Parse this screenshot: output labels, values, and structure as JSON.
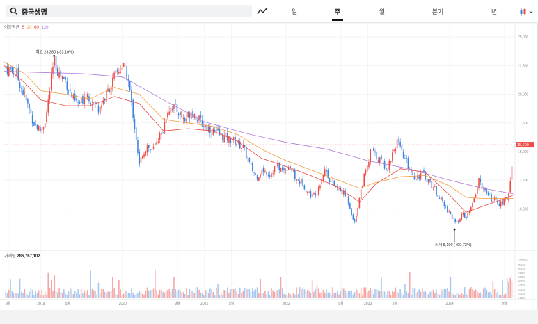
{
  "header": {
    "stock_name": "중국생명",
    "search_icon": "search-icon",
    "chart_type_icon": "line-chart-icon",
    "chart_style_icon": "candlestick-icon",
    "tabs": [
      {
        "label": "일",
        "active": false
      },
      {
        "label": "주",
        "active": true
      },
      {
        "label": "월",
        "active": false
      },
      {
        "label": "분기",
        "active": false
      },
      {
        "label": "년",
        "active": false
      }
    ]
  },
  "legend": {
    "title": "이동평균",
    "periods": [
      {
        "label": "5",
        "color": "#e8453c"
      },
      {
        "label": "20",
        "color": "#f29a3a"
      },
      {
        "label": "60",
        "color": "#e8453c"
      },
      {
        "label": "120",
        "color": "#b07ad8"
      }
    ]
  },
  "volume": {
    "label": "거래량",
    "value": "286,767,102"
  },
  "colors": {
    "up": "#ee4b45",
    "down": "#3b82e0",
    "ma5": "#e8453c",
    "ma20": "#f29a3a",
    "ma60": "#e8453c",
    "ma120": "#b07ad8",
    "current_badge": "#ee4b45"
  },
  "chart_data": {
    "type": "candlestick",
    "title": "",
    "xlabel": "",
    "ylabel": "",
    "ylim": [
      6500,
      25800
    ],
    "y_ticks": [
      {
        "value": 25000,
        "label": "25,000"
      },
      {
        "value": 22500,
        "label": "22,500"
      },
      {
        "value": 20000,
        "label": "20,000"
      },
      {
        "value": 17500,
        "label": "17,500"
      },
      {
        "value": 15000,
        "label": "15,000"
      },
      {
        "value": 12500,
        "label": "12,500"
      },
      {
        "value": 10000,
        "label": "10,000"
      }
    ],
    "x_ticks": [
      "9월",
      "2019",
      "5월",
      "2020",
      "9월",
      "2021",
      "5월",
      "2022",
      "9월",
      "2023",
      "5월",
      "2024",
      "9월"
    ],
    "price_path": [
      [
        2018.58,
        22300
      ],
      [
        2018.7,
        21800
      ],
      [
        2018.8,
        19800
      ],
      [
        2018.92,
        17400
      ],
      [
        2019.0,
        16800
      ],
      [
        2019.06,
        17900
      ],
      [
        2019.12,
        21000
      ],
      [
        2019.16,
        22900
      ],
      [
        2019.22,
        21800
      ],
      [
        2019.3,
        21200
      ],
      [
        2019.4,
        19400
      ],
      [
        2019.48,
        19100
      ],
      [
        2019.55,
        20200
      ],
      [
        2019.62,
        19500
      ],
      [
        2019.7,
        18800
      ],
      [
        2019.76,
        19400
      ],
      [
        2019.82,
        20300
      ],
      [
        2019.88,
        21200
      ],
      [
        2019.94,
        22000
      ],
      [
        2020.0,
        22500
      ],
      [
        2020.06,
        21500
      ],
      [
        2020.1,
        19600
      ],
      [
        2020.16,
        16500
      ],
      [
        2020.2,
        13600
      ],
      [
        2020.24,
        14800
      ],
      [
        2020.3,
        15500
      ],
      [
        2020.36,
        14900
      ],
      [
        2020.42,
        16100
      ],
      [
        2020.48,
        16500
      ],
      [
        2020.54,
        18500
      ],
      [
        2020.6,
        19000
      ],
      [
        2020.68,
        18500
      ],
      [
        2020.76,
        17700
      ],
      [
        2020.84,
        18600
      ],
      [
        2020.92,
        17800
      ],
      [
        2021.0,
        17300
      ],
      [
        2021.1,
        16800
      ],
      [
        2021.2,
        16400
      ],
      [
        2021.3,
        16100
      ],
      [
        2021.4,
        15800
      ],
      [
        2021.48,
        15300
      ],
      [
        2021.56,
        13700
      ],
      [
        2021.64,
        12800
      ],
      [
        2021.72,
        13400
      ],
      [
        2021.8,
        13000
      ],
      [
        2021.88,
        13800
      ],
      [
        2021.96,
        13300
      ],
      [
        2022.04,
        13800
      ],
      [
        2022.12,
        12500
      ],
      [
        2022.2,
        12300
      ],
      [
        2022.26,
        11500
      ],
      [
        2022.32,
        11100
      ],
      [
        2022.38,
        11600
      ],
      [
        2022.44,
        12800
      ],
      [
        2022.48,
        13500
      ],
      [
        2022.54,
        12400
      ],
      [
        2022.62,
        11800
      ],
      [
        2022.7,
        11400
      ],
      [
        2022.76,
        10700
      ],
      [
        2022.8,
        9700
      ],
      [
        2022.84,
        8700
      ],
      [
        2022.88,
        10400
      ],
      [
        2022.94,
        12500
      ],
      [
        2023.0,
        13700
      ],
      [
        2023.04,
        15300
      ],
      [
        2023.08,
        14700
      ],
      [
        2023.16,
        14200
      ],
      [
        2023.24,
        13500
      ],
      [
        2023.3,
        14900
      ],
      [
        2023.36,
        15900
      ],
      [
        2023.42,
        14700
      ],
      [
        2023.5,
        13700
      ],
      [
        2023.58,
        12700
      ],
      [
        2023.66,
        13100
      ],
      [
        2023.74,
        12500
      ],
      [
        2023.82,
        11700
      ],
      [
        2023.88,
        11000
      ],
      [
        2023.94,
        10200
      ],
      [
        2024.0,
        9700
      ],
      [
        2024.04,
        9100
      ],
      [
        2024.08,
        8600
      ],
      [
        2024.14,
        9500
      ],
      [
        2024.2,
        9200
      ],
      [
        2024.26,
        10000
      ],
      [
        2024.3,
        10800
      ],
      [
        2024.36,
        12600
      ],
      [
        2024.42,
        11600
      ],
      [
        2024.5,
        10900
      ],
      [
        2024.56,
        10700
      ],
      [
        2024.62,
        10400
      ],
      [
        2024.68,
        10700
      ],
      [
        2024.72,
        11200
      ],
      [
        2024.76,
        13500
      ],
      [
        2024.78,
        15600
      ]
    ],
    "moving_averages": [
      {
        "name": "120",
        "points": [
          [
            2018.55,
            22000
          ],
          [
            2019.0,
            21900
          ],
          [
            2019.5,
            21800
          ],
          [
            2020.0,
            21500
          ],
          [
            2020.5,
            19500
          ],
          [
            2021.0,
            17600
          ],
          [
            2021.5,
            16600
          ],
          [
            2022.0,
            15800
          ],
          [
            2022.5,
            15200
          ],
          [
            2023.0,
            14200
          ],
          [
            2023.5,
            13500
          ],
          [
            2024.0,
            12500
          ],
          [
            2024.4,
            11800
          ],
          [
            2024.78,
            11300
          ]
        ]
      },
      {
        "name": "60",
        "points": [
          [
            2018.55,
            22500
          ],
          [
            2018.8,
            21000
          ],
          [
            2019.0,
            19500
          ],
          [
            2019.3,
            19000
          ],
          [
            2019.6,
            19000
          ],
          [
            2019.9,
            19800
          ],
          [
            2020.2,
            19200
          ],
          [
            2020.5,
            16800
          ],
          [
            2020.8,
            17000
          ],
          [
            2021.1,
            16800
          ],
          [
            2021.4,
            15900
          ],
          [
            2021.7,
            14400
          ],
          [
            2022.0,
            13700
          ],
          [
            2022.3,
            12900
          ],
          [
            2022.6,
            12000
          ],
          [
            2022.9,
            10600
          ],
          [
            2023.1,
            12200
          ],
          [
            2023.4,
            13500
          ],
          [
            2023.7,
            13200
          ],
          [
            2024.0,
            11200
          ],
          [
            2024.2,
            9700
          ],
          [
            2024.4,
            10200
          ],
          [
            2024.6,
            10700
          ],
          [
            2024.78,
            11200
          ]
        ]
      },
      {
        "name": "20",
        "points": [
          [
            2018.55,
            22800
          ],
          [
            2018.8,
            21800
          ],
          [
            2019.0,
            20300
          ],
          [
            2019.3,
            20000
          ],
          [
            2019.6,
            19600
          ],
          [
            2019.9,
            20600
          ],
          [
            2020.2,
            20000
          ],
          [
            2020.5,
            17800
          ],
          [
            2020.8,
            17500
          ],
          [
            2021.1,
            17200
          ],
          [
            2021.4,
            16500
          ],
          [
            2021.7,
            15200
          ],
          [
            2022.0,
            14200
          ],
          [
            2022.3,
            13400
          ],
          [
            2022.6,
            12600
          ],
          [
            2022.9,
            11800
          ],
          [
            2023.1,
            12300
          ],
          [
            2023.4,
            12800
          ],
          [
            2023.7,
            12900
          ],
          [
            2024.0,
            12000
          ],
          [
            2024.2,
            11000
          ],
          [
            2024.4,
            10900
          ],
          [
            2024.6,
            10900
          ],
          [
            2024.78,
            10900
          ]
        ]
      }
    ],
    "current_price": {
      "value": 15600,
      "label": "15,600"
    },
    "annotations": [
      {
        "text": "최고 23,350 (-33.10%)",
        "x": 2019.16,
        "y": 23350
      },
      {
        "text": "최저 8,190 (+90.72%)",
        "x": 2024.06,
        "y": 8190
      }
    ],
    "volume_ticks": [
      "1000m",
      "900m",
      "800m",
      "700m",
      "600m",
      "500m",
      "400m",
      "300m",
      "200m",
      "100m"
    ],
    "grid": true
  }
}
